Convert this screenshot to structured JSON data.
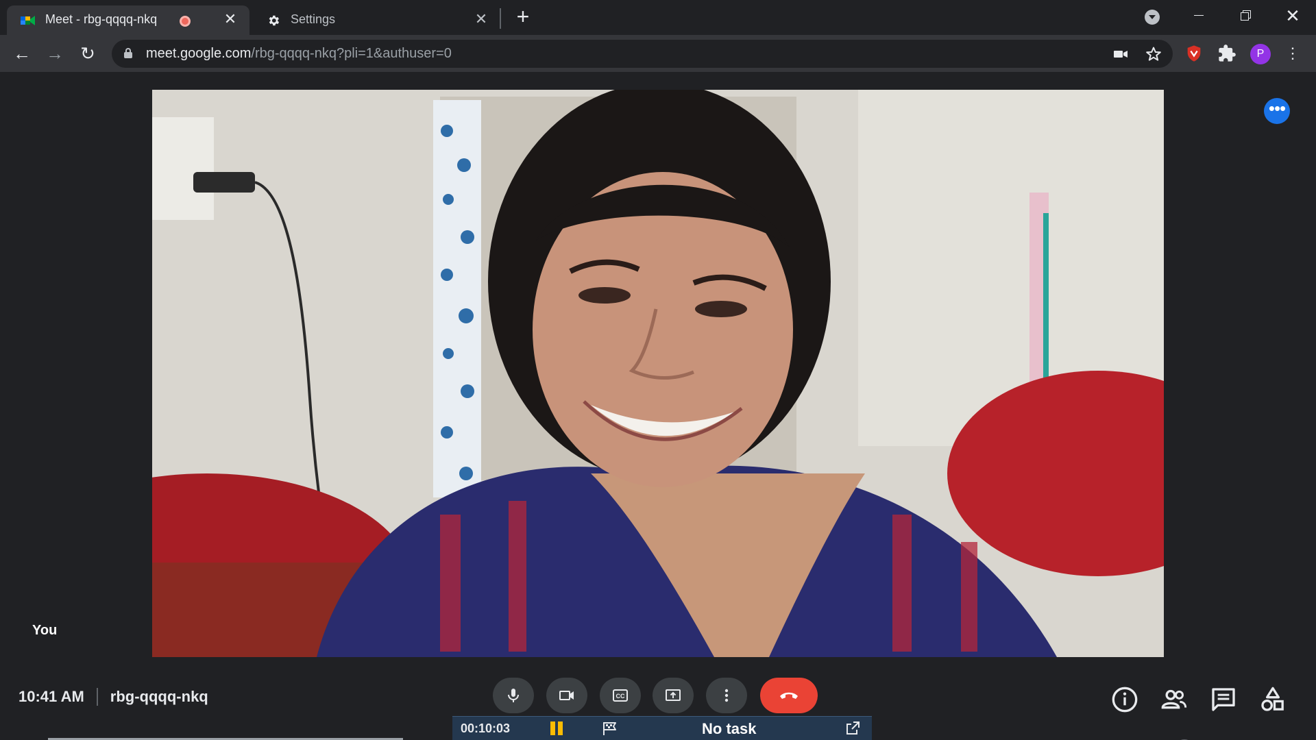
{
  "browser": {
    "tabs": [
      {
        "title": "Meet - rbg-qqqq-nkq",
        "active": true,
        "recording": true
      },
      {
        "title": "Settings",
        "active": false
      }
    ],
    "new_tab_symbol": "+",
    "url_host": "meet.google.com",
    "url_path": "/rbg-qqqq-nkq?pli=1&authuser=0",
    "profile_initial": "P"
  },
  "meet": {
    "self_label": "You",
    "time": "10:41 AM",
    "meeting_code": "rbg-qqqq-nkq",
    "participants_count": "1",
    "controls": [
      "microphone",
      "camera",
      "captions",
      "present-now",
      "more-options",
      "leave-call"
    ],
    "right_controls": [
      "meeting-details",
      "people",
      "chat",
      "activities"
    ]
  },
  "task_bar": {
    "elapsed": "00:10:03",
    "label": "No task"
  },
  "colors": {
    "background": "#202124",
    "hangup": "#ea4335",
    "accent_blue": "#1a73e8",
    "profile": "#9334e6",
    "task_bar": "#24384f",
    "pause": "#fbbc04"
  }
}
